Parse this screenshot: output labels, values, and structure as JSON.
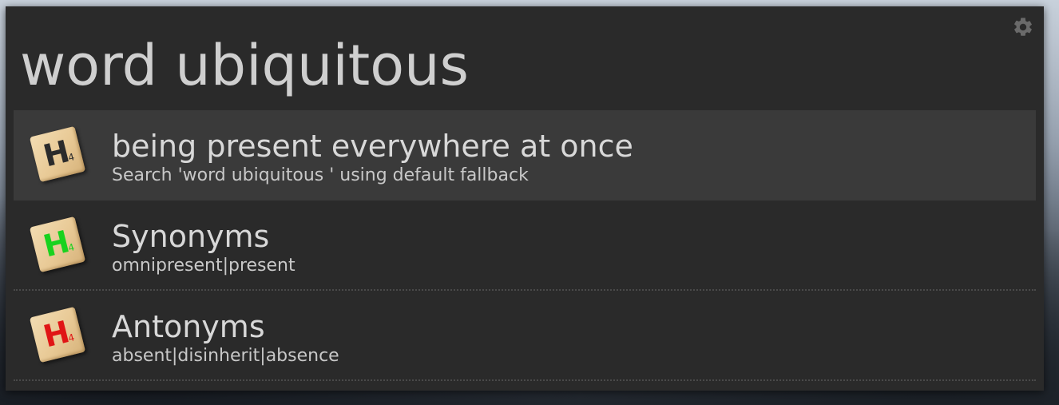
{
  "search": {
    "query": "word ubiquitous"
  },
  "settings": {
    "icon": "gear-icon",
    "color": "#6a6a6a"
  },
  "results": [
    {
      "title": "being present everywhere at once",
      "subtitle": "Search 'word ubiquitous ' using default fallback",
      "icon": "scrabble-tile-icon",
      "tile_letter": "H",
      "tile_number": "4",
      "letter_color": "#2b2b2b",
      "selected": true
    },
    {
      "title": "Synonyms",
      "subtitle": "omnipresent|present",
      "icon": "scrabble-tile-icon",
      "tile_letter": "H",
      "tile_number": "4",
      "letter_color": "#19d21f",
      "selected": false
    },
    {
      "title": "Antonyms",
      "subtitle": "absent|disinherit|absence",
      "icon": "scrabble-tile-icon",
      "tile_letter": "H",
      "tile_number": "4",
      "letter_color": "#e01515",
      "selected": false
    }
  ],
  "colors": {
    "panel_bg": "#2a2a2a",
    "selected_bg": "#3a3a3a",
    "text": "#d8d8d8"
  }
}
